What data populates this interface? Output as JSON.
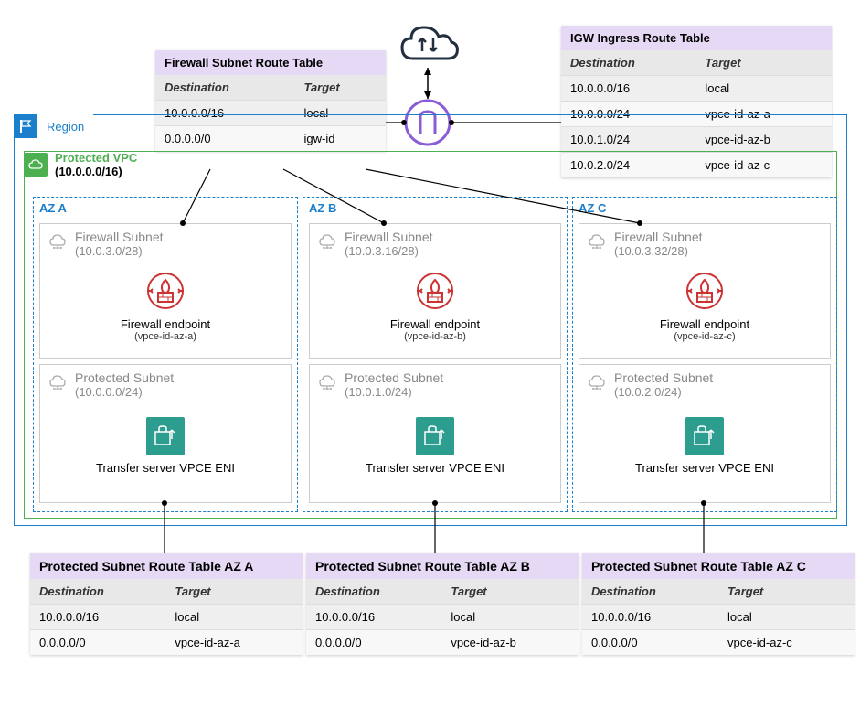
{
  "region_label": "Region",
  "vpc": {
    "name": "Protected VPC",
    "cidr": "(10.0.0.0/16)"
  },
  "firewall_table": {
    "title": "Firewall Subnet Route Table",
    "col1": "Destination",
    "col2": "Target",
    "rows": [
      {
        "dest": "10.0.0.0/16",
        "target": "local"
      },
      {
        "dest": "0.0.0.0/0",
        "target": "igw-id"
      }
    ]
  },
  "igw_table": {
    "title": "IGW Ingress Route Table",
    "col1": "Destination",
    "col2": "Target",
    "rows": [
      {
        "dest": "10.0.0.0/16",
        "target": "local"
      },
      {
        "dest": "10.0.0.0/24",
        "target": "vpce-id-az-a"
      },
      {
        "dest": "10.0.1.0/24",
        "target": "vpce-id-az-b"
      },
      {
        "dest": "10.0.2.0/24",
        "target": "vpce-id-az-c"
      }
    ]
  },
  "az": {
    "a": {
      "label": "AZ A",
      "fw_subnet_name": "Firewall Subnet",
      "fw_subnet_cidr": "(10.0.3.0/28)",
      "fw_ep_label": "Firewall endpoint",
      "fw_ep_sub": "(vpce-id-az-a)",
      "prot_subnet_name": "Protected Subnet",
      "prot_subnet_cidr": "(10.0.0.0/24)",
      "vpce_label": "Transfer server VPCE ENI"
    },
    "b": {
      "label": "AZ B",
      "fw_subnet_name": "Firewall Subnet",
      "fw_subnet_cidr": "(10.0.3.16/28)",
      "fw_ep_label": "Firewall endpoint",
      "fw_ep_sub": "(vpce-id-az-b)",
      "prot_subnet_name": "Protected Subnet",
      "prot_subnet_cidr": "(10.0.1.0/24)",
      "vpce_label": "Transfer server VPCE ENI"
    },
    "c": {
      "label": "AZ C",
      "fw_subnet_name": "Firewall Subnet",
      "fw_subnet_cidr": "(10.0.3.32/28)",
      "fw_ep_label": "Firewall endpoint",
      "fw_ep_sub": "(vpce-id-az-c)",
      "prot_subnet_name": "Protected Subnet",
      "prot_subnet_cidr": "(10.0.2.0/24)",
      "vpce_label": "Transfer server VPCE ENI"
    }
  },
  "protected_tables": {
    "a": {
      "title": "Protected Subnet Route Table AZ A",
      "col1": "Destination",
      "col2": "Target",
      "rows": [
        {
          "dest": "10.0.0.0/16",
          "target": "local"
        },
        {
          "dest": "0.0.0.0/0",
          "target": "vpce-id-az-a"
        }
      ]
    },
    "b": {
      "title": "Protected Subnet Route Table AZ B",
      "col1": "Destination",
      "col2": "Target",
      "rows": [
        {
          "dest": "10.0.0.0/16",
          "target": "local"
        },
        {
          "dest": "0.0.0.0/0",
          "target": "vpce-id-az-b"
        }
      ]
    },
    "c": {
      "title": "Protected Subnet Route Table AZ C",
      "col1": "Destination",
      "col2": "Target",
      "rows": [
        {
          "dest": "10.0.0.0/16",
          "target": "local"
        },
        {
          "dest": "0.0.0.0/0",
          "target": "vpce-id-az-c"
        }
      ]
    }
  }
}
